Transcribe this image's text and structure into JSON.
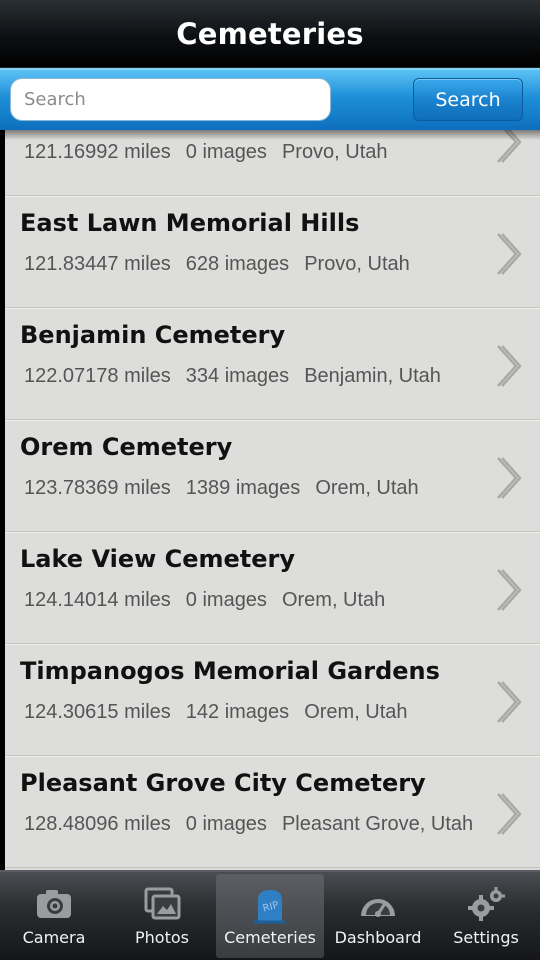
{
  "header": {
    "title": "Cemeteries"
  },
  "search": {
    "placeholder": "Search",
    "button_label": "Search"
  },
  "cemeteries": [
    {
      "name": "",
      "distance": "121.16992 miles",
      "images": "0 images",
      "location": "Provo, Utah"
    },
    {
      "name": "East Lawn Memorial Hills",
      "distance": "121.83447 miles",
      "images": "628 images",
      "location": "Provo, Utah"
    },
    {
      "name": "Benjamin Cemetery",
      "distance": "122.07178 miles",
      "images": "334 images",
      "location": "Benjamin, Utah"
    },
    {
      "name": "Orem Cemetery",
      "distance": "123.78369 miles",
      "images": "1389 images",
      "location": "Orem, Utah"
    },
    {
      "name": "Lake View Cemetery",
      "distance": "124.14014 miles",
      "images": "0 images",
      "location": "Orem, Utah"
    },
    {
      "name": "Timpanogos Memorial Gardens",
      "distance": "124.30615 miles",
      "images": "142 images",
      "location": "Orem, Utah"
    },
    {
      "name": "Pleasant Grove City Cemetery",
      "distance": "128.48096 miles",
      "images": "0 images",
      "location": "Pleasant Grove, Utah"
    }
  ],
  "tabs": [
    {
      "label": "Camera",
      "icon": "camera-icon",
      "active": false
    },
    {
      "label": "Photos",
      "icon": "photos-icon",
      "active": false
    },
    {
      "label": "Cemeteries",
      "icon": "headstone-icon",
      "active": true
    },
    {
      "label": "Dashboard",
      "icon": "gauge-icon",
      "active": false
    },
    {
      "label": "Settings",
      "icon": "gears-icon",
      "active": false
    }
  ],
  "colors": {
    "accent": "#1e8fd8",
    "list_bg": "#dddedb",
    "tabbar": "#2b2e31"
  }
}
